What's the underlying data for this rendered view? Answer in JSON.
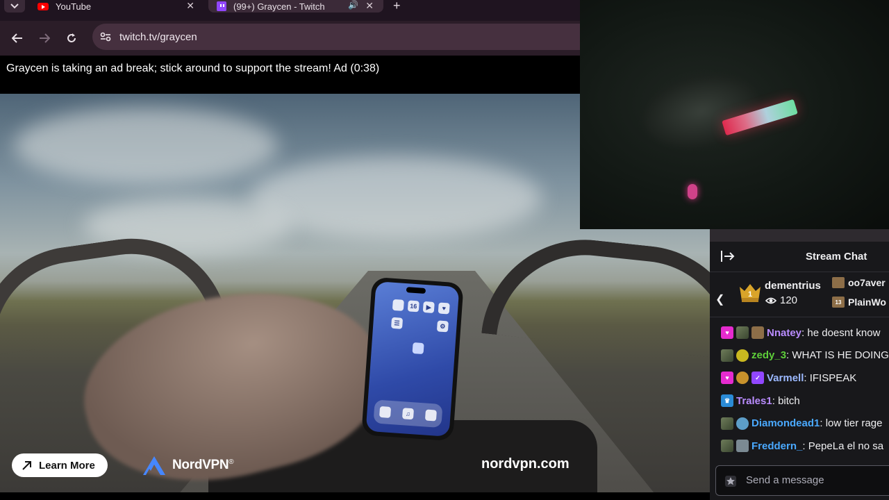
{
  "browser": {
    "tabs": [
      {
        "title": "YouTube"
      },
      {
        "title": "(99+) Graycen - Twitch"
      }
    ],
    "url": "twitch.tv/graycen"
  },
  "ad": {
    "notice": "Graycen is taking an ad break; stick around to support the stream! Ad (0:38)",
    "learn_more": "Learn More",
    "brand": "NordVPN",
    "brand_mark": "®",
    "brand_url": "nordvpn.com",
    "phone_apps": [
      "16"
    ]
  },
  "chat": {
    "title": "Stream Chat",
    "leaderboard": {
      "top_rank": "1",
      "top_name": "dementrius",
      "top_count": "120",
      "second_name": "oo7aver",
      "third_name": "PlainWo",
      "badge_label": "13"
    },
    "messages": [
      {
        "user": "Nnatey",
        "color": "#b98cff",
        "text": "he doesnt know"
      },
      {
        "user": "zedy_3",
        "color": "#5ecf3a",
        "text": "WHAT IS HE DOING"
      },
      {
        "user": "Varmell",
        "color": "#9bb8ff",
        "text": "IFISPEAK"
      },
      {
        "user": "Trales1",
        "color": "#b98cff",
        "text": "bitch"
      },
      {
        "user": "Diamondead1",
        "color": "#4aa9ff",
        "text": "low tier rage"
      },
      {
        "user": "Freddern_",
        "color": "#4aa9ff",
        "text": "PepeLa el no sa"
      }
    ],
    "input_placeholder": "Send a message"
  }
}
